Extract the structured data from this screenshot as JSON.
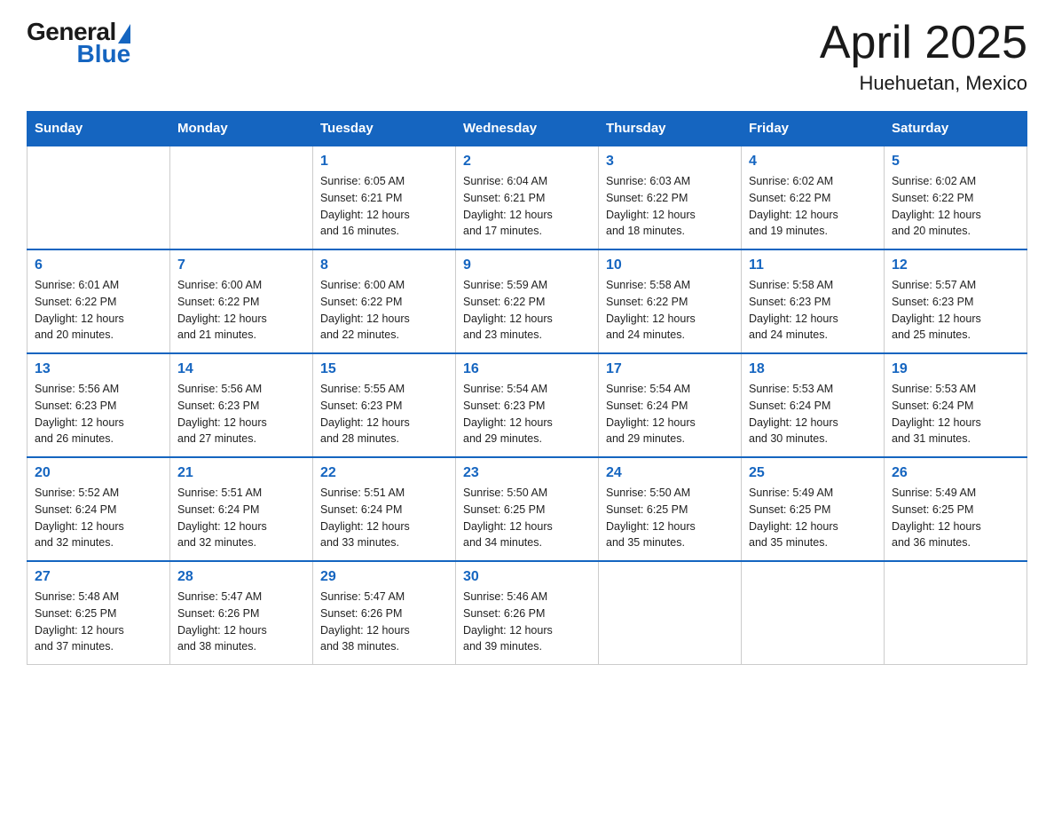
{
  "header": {
    "logo": {
      "general": "General",
      "blue": "Blue"
    },
    "title": "April 2025",
    "subtitle": "Huehuetan, Mexico"
  },
  "weekdays": [
    "Sunday",
    "Monday",
    "Tuesday",
    "Wednesday",
    "Thursday",
    "Friday",
    "Saturday"
  ],
  "weeks": [
    [
      {
        "day": "",
        "info": ""
      },
      {
        "day": "",
        "info": ""
      },
      {
        "day": "1",
        "info": "Sunrise: 6:05 AM\nSunset: 6:21 PM\nDaylight: 12 hours\nand 16 minutes."
      },
      {
        "day": "2",
        "info": "Sunrise: 6:04 AM\nSunset: 6:21 PM\nDaylight: 12 hours\nand 17 minutes."
      },
      {
        "day": "3",
        "info": "Sunrise: 6:03 AM\nSunset: 6:22 PM\nDaylight: 12 hours\nand 18 minutes."
      },
      {
        "day": "4",
        "info": "Sunrise: 6:02 AM\nSunset: 6:22 PM\nDaylight: 12 hours\nand 19 minutes."
      },
      {
        "day": "5",
        "info": "Sunrise: 6:02 AM\nSunset: 6:22 PM\nDaylight: 12 hours\nand 20 minutes."
      }
    ],
    [
      {
        "day": "6",
        "info": "Sunrise: 6:01 AM\nSunset: 6:22 PM\nDaylight: 12 hours\nand 20 minutes."
      },
      {
        "day": "7",
        "info": "Sunrise: 6:00 AM\nSunset: 6:22 PM\nDaylight: 12 hours\nand 21 minutes."
      },
      {
        "day": "8",
        "info": "Sunrise: 6:00 AM\nSunset: 6:22 PM\nDaylight: 12 hours\nand 22 minutes."
      },
      {
        "day": "9",
        "info": "Sunrise: 5:59 AM\nSunset: 6:22 PM\nDaylight: 12 hours\nand 23 minutes."
      },
      {
        "day": "10",
        "info": "Sunrise: 5:58 AM\nSunset: 6:22 PM\nDaylight: 12 hours\nand 24 minutes."
      },
      {
        "day": "11",
        "info": "Sunrise: 5:58 AM\nSunset: 6:23 PM\nDaylight: 12 hours\nand 24 minutes."
      },
      {
        "day": "12",
        "info": "Sunrise: 5:57 AM\nSunset: 6:23 PM\nDaylight: 12 hours\nand 25 minutes."
      }
    ],
    [
      {
        "day": "13",
        "info": "Sunrise: 5:56 AM\nSunset: 6:23 PM\nDaylight: 12 hours\nand 26 minutes."
      },
      {
        "day": "14",
        "info": "Sunrise: 5:56 AM\nSunset: 6:23 PM\nDaylight: 12 hours\nand 27 minutes."
      },
      {
        "day": "15",
        "info": "Sunrise: 5:55 AM\nSunset: 6:23 PM\nDaylight: 12 hours\nand 28 minutes."
      },
      {
        "day": "16",
        "info": "Sunrise: 5:54 AM\nSunset: 6:23 PM\nDaylight: 12 hours\nand 29 minutes."
      },
      {
        "day": "17",
        "info": "Sunrise: 5:54 AM\nSunset: 6:24 PM\nDaylight: 12 hours\nand 29 minutes."
      },
      {
        "day": "18",
        "info": "Sunrise: 5:53 AM\nSunset: 6:24 PM\nDaylight: 12 hours\nand 30 minutes."
      },
      {
        "day": "19",
        "info": "Sunrise: 5:53 AM\nSunset: 6:24 PM\nDaylight: 12 hours\nand 31 minutes."
      }
    ],
    [
      {
        "day": "20",
        "info": "Sunrise: 5:52 AM\nSunset: 6:24 PM\nDaylight: 12 hours\nand 32 minutes."
      },
      {
        "day": "21",
        "info": "Sunrise: 5:51 AM\nSunset: 6:24 PM\nDaylight: 12 hours\nand 32 minutes."
      },
      {
        "day": "22",
        "info": "Sunrise: 5:51 AM\nSunset: 6:24 PM\nDaylight: 12 hours\nand 33 minutes."
      },
      {
        "day": "23",
        "info": "Sunrise: 5:50 AM\nSunset: 6:25 PM\nDaylight: 12 hours\nand 34 minutes."
      },
      {
        "day": "24",
        "info": "Sunrise: 5:50 AM\nSunset: 6:25 PM\nDaylight: 12 hours\nand 35 minutes."
      },
      {
        "day": "25",
        "info": "Sunrise: 5:49 AM\nSunset: 6:25 PM\nDaylight: 12 hours\nand 35 minutes."
      },
      {
        "day": "26",
        "info": "Sunrise: 5:49 AM\nSunset: 6:25 PM\nDaylight: 12 hours\nand 36 minutes."
      }
    ],
    [
      {
        "day": "27",
        "info": "Sunrise: 5:48 AM\nSunset: 6:25 PM\nDaylight: 12 hours\nand 37 minutes."
      },
      {
        "day": "28",
        "info": "Sunrise: 5:47 AM\nSunset: 6:26 PM\nDaylight: 12 hours\nand 38 minutes."
      },
      {
        "day": "29",
        "info": "Sunrise: 5:47 AM\nSunset: 6:26 PM\nDaylight: 12 hours\nand 38 minutes."
      },
      {
        "day": "30",
        "info": "Sunrise: 5:46 AM\nSunset: 6:26 PM\nDaylight: 12 hours\nand 39 minutes."
      },
      {
        "day": "",
        "info": ""
      },
      {
        "day": "",
        "info": ""
      },
      {
        "day": "",
        "info": ""
      }
    ]
  ]
}
